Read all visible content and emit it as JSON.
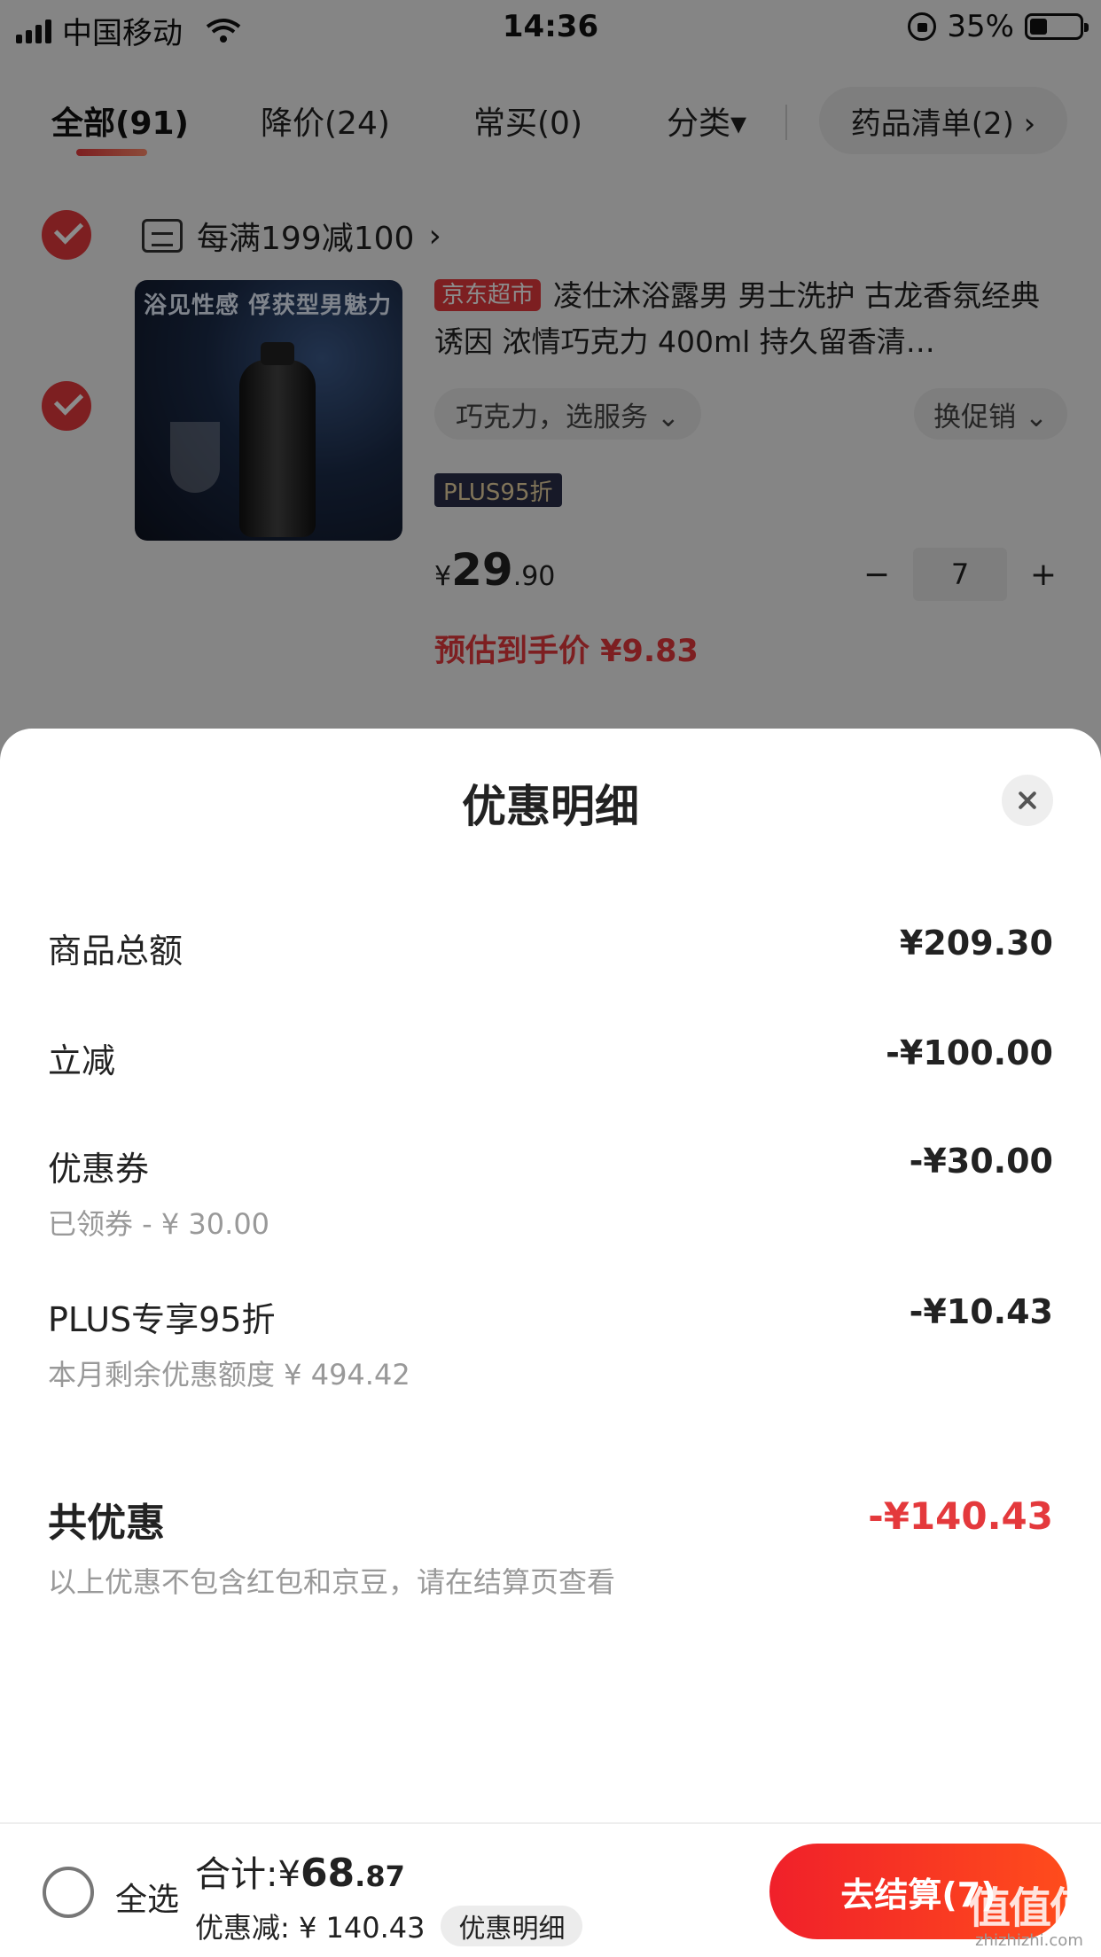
{
  "status_bar": {
    "carrier": "中国移动",
    "time": "14:36",
    "battery": "35%",
    "battery_level": 0.35
  },
  "tabs": {
    "items": [
      {
        "label": "全部(91)",
        "active": true
      },
      {
        "label": "降价(24)"
      },
      {
        "label": "常买(0)"
      },
      {
        "label": "分类▾"
      }
    ],
    "pill_label": "药品清单(2) ›"
  },
  "cart": {
    "promo_label": "每满199减100",
    "promo_chevron": "›",
    "product": {
      "image_text": "浴见性感 俘获型男魅力",
      "store_tag": "京东超市",
      "title": "凌仕沐浴露男 男士洗护 古龙香氛经典诱因 浓情巧克力 400ml 持久留香清…",
      "spec": "巧克力，选服务 ⌄",
      "promo": "换促销 ⌄",
      "plus_tag": "PLUS95折",
      "price_currency": "¥",
      "price_int": "29",
      "price_dec": ".90",
      "qty_minus": "−",
      "qty": "7",
      "qty_plus": "+",
      "est_price": "预估到手价 ¥9.83"
    }
  },
  "sheet": {
    "title": "优惠明细",
    "rows": [
      {
        "label": "商品总额",
        "value": "¥209.30"
      },
      {
        "label": "立减",
        "value": "-¥100.00"
      },
      {
        "label": "优惠券",
        "value": "-¥30.00",
        "sub": "已领券 - ¥ 30.00"
      },
      {
        "label": "PLUS专享95折",
        "value": "-¥10.43",
        "sub": "本月剩余优惠额度 ¥ 494.42"
      }
    ],
    "total_label": "共优惠",
    "total_value": "-¥140.43",
    "total_note": "以上优惠不包含红包和京豆，请在结算页查看"
  },
  "bottom_bar": {
    "select_all": "全选",
    "sum_label": "合计:¥",
    "sum_int": "68",
    "sum_dec": ".87",
    "discount_text": "优惠减: ¥ 140.43",
    "detail_chip": "优惠明细",
    "checkout": "去结算(7)"
  },
  "watermark": {
    "big": "值值值",
    "small": "zhizhizhi.com"
  },
  "colors": {
    "accent": "#e4393c",
    "checkout_start": "#f0202a",
    "checkout_end": "#ff4c1c"
  }
}
